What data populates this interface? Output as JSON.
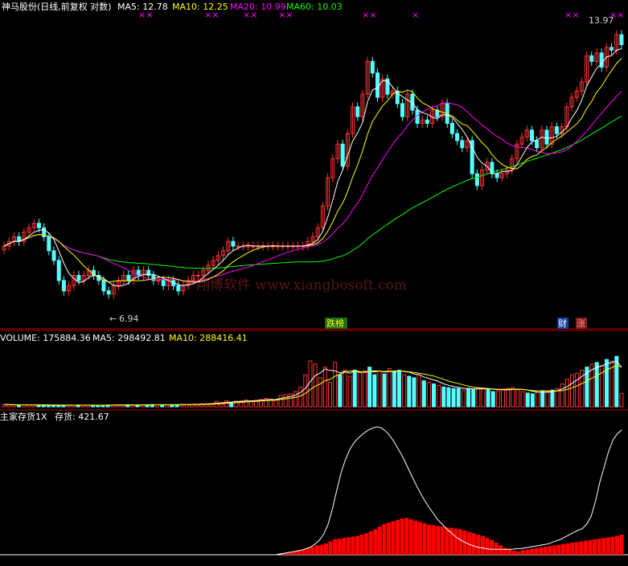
{
  "header": {
    "title": "神马股份(日线,前复权 对数)",
    "ma_items": [
      {
        "label": "MA5: 12.78",
        "color": "#ffffff"
      },
      {
        "label": "MA10: 12.25",
        "color": "#ffff00"
      },
      {
        "label": "MA20: 10.99",
        "color": "#ff00ff"
      },
      {
        "label": "MA60: 10.03",
        "color": "#00ff00"
      }
    ]
  },
  "price_panel": {
    "high_label": "13.97",
    "low_label": "6.94",
    "watermark": "翔博软件 www.xiangbosoft.com",
    "event_tags": [
      {
        "text": "跌榜",
        "color": "#ffff00",
        "bg": "#1a6a1a"
      },
      {
        "text": "财",
        "color": "#ffffff",
        "bg": "#1040a0"
      },
      {
        "text": "涨",
        "color": "#ff8080",
        "bg": "#802020"
      }
    ],
    "star_marks": [
      "××",
      "××",
      "××",
      "××",
      "××",
      "×",
      "××",
      "××"
    ]
  },
  "volume_panel": {
    "items": [
      {
        "label": "VOLUME: 175884.36",
        "color": "#ffffff"
      },
      {
        "label": "MA5: 298492.81",
        "color": "#ffffff"
      },
      {
        "label": "MA10: 288416.41",
        "color": "#ffff00"
      }
    ]
  },
  "indicator_panel": {
    "items": [
      {
        "label": "主家存货1X",
        "color": "#ffffff"
      },
      {
        "label": "存货: 421.67",
        "color": "#ffffff"
      }
    ]
  },
  "colors": {
    "up": "#ff3232",
    "down": "#54ffff",
    "ma5": "#ffffff",
    "ma10": "#ffff00",
    "ma20": "#ff00ff",
    "ma60": "#00ff00",
    "axis": "#b00000",
    "inventory_bar": "#ff0000",
    "inventory_line": "#ffffff"
  },
  "chart_data": [
    {
      "type": "candlestick",
      "title": "神马股份(日线,前复权 对数)",
      "scale": "log",
      "ylim": [
        6.5,
        14.5
      ],
      "closes": [
        7.9,
        8.0,
        8.1,
        8.0,
        8.2,
        8.3,
        8.4,
        8.3,
        8.1,
        7.8,
        7.6,
        7.2,
        7.0,
        7.1,
        7.3,
        7.2,
        7.3,
        7.4,
        7.3,
        7.2,
        7.0,
        6.94,
        7.1,
        7.2,
        7.3,
        7.2,
        7.4,
        7.3,
        7.4,
        7.3,
        7.2,
        7.2,
        7.1,
        7.2,
        7.1,
        7.0,
        7.1,
        7.2,
        7.3,
        7.3,
        7.4,
        7.5,
        7.6,
        7.7,
        7.8,
        8.0,
        7.9,
        7.9,
        7.9,
        7.9,
        7.9,
        7.9,
        7.9,
        7.9,
        7.9,
        7.9,
        7.9,
        7.9,
        7.9,
        7.9,
        7.9,
        8.0,
        8.1,
        8.3,
        8.8,
        9.5,
        10.0,
        10.4,
        9.8,
        10.7,
        11.5,
        11.2,
        11.9,
        13.0,
        12.6,
        11.8,
        12.4,
        11.9,
        12.0,
        11.6,
        11.2,
        11.9,
        11.4,
        11.0,
        11.1,
        11.0,
        11.4,
        11.2,
        11.6,
        11.0,
        10.7,
        10.5,
        10.3,
        10.5,
        9.6,
        9.3,
        9.7,
        9.9,
        9.6,
        9.5,
        9.6,
        9.7,
        10.0,
        10.4,
        10.6,
        10.8,
        10.5,
        10.3,
        10.8,
        10.4,
        10.9,
        10.7,
        10.9,
        11.5,
        11.8,
        12.0,
        12.3,
        13.2,
        13.0,
        13.3,
        12.8,
        13.5,
        13.4,
        13.97,
        13.6
      ],
      "ma5": 12.78,
      "ma10": 12.25,
      "ma20": 10.99,
      "ma60": 10.03,
      "high_mark": 13.97,
      "low_mark": 6.94
    },
    {
      "type": "bar",
      "title": "VOLUME",
      "ylim": [
        0,
        800000
      ],
      "values": [
        30000,
        28000,
        25000,
        22000,
        27000,
        26000,
        24000,
        23000,
        22000,
        20000,
        21000,
        19000,
        18000,
        20000,
        22000,
        24000,
        23000,
        21000,
        20000,
        19000,
        22000,
        24000,
        23000,
        26000,
        25000,
        27000,
        24000,
        23000,
        26000,
        28000,
        30000,
        27000,
        26000,
        25000,
        28000,
        29000,
        32000,
        30000,
        33000,
        35000,
        40000,
        42000,
        45000,
        70000,
        55000,
        80000,
        60000,
        75000,
        80000,
        90000,
        78000,
        85000,
        95000,
        110000,
        100000,
        90000,
        150000,
        160000,
        170000,
        200000,
        260000,
        420000,
        600000,
        560000,
        380000,
        520000,
        320000,
        580000,
        420000,
        480000,
        400000,
        480000,
        460000,
        470000,
        520000,
        420000,
        470000,
        430000,
        500000,
        470000,
        480000,
        420000,
        400000,
        380000,
        420000,
        340000,
        320000,
        300000,
        280000,
        260000,
        250000,
        240000,
        240000,
        220000,
        240000,
        230000,
        250000,
        240000,
        230000,
        200000,
        210000,
        230000,
        240000,
        250000,
        220000,
        200000,
        180000,
        170000,
        190000,
        210000,
        200000,
        220000,
        240000,
        300000,
        360000,
        420000,
        440000,
        480000,
        520000,
        560000,
        580000,
        540000,
        620000,
        600000,
        660000,
        175884
      ],
      "ma5": 298492.81,
      "ma10": 288416.41
    },
    {
      "type": "bar",
      "title": "主家存货1X",
      "value_label": 421.67,
      "bars": [
        0,
        0,
        0,
        0,
        0,
        0,
        0,
        0,
        0,
        0,
        0,
        0,
        0,
        0,
        0,
        0,
        0,
        0,
        0,
        0,
        0,
        0,
        0,
        0,
        0,
        0,
        0,
        0,
        0,
        0,
        0,
        0,
        0,
        0,
        0,
        0,
        0,
        0,
        0,
        0,
        0,
        0,
        0,
        0,
        0,
        0,
        0,
        0,
        0,
        0,
        0,
        0,
        0,
        0,
        0,
        0,
        0,
        0,
        0,
        0,
        0,
        0,
        0,
        3,
        4,
        5,
        7,
        8,
        10,
        12,
        14,
        15,
        17,
        20,
        23,
        24,
        25,
        26,
        27,
        28,
        30,
        32,
        35,
        38,
        42,
        46,
        48,
        50,
        52,
        54,
        55,
        53,
        51,
        49,
        47,
        45,
        44,
        43,
        42,
        41,
        40,
        39,
        38,
        36,
        34,
        32,
        30,
        28,
        25,
        22,
        18,
        14,
        10,
        8,
        6,
        5,
        7,
        8,
        9,
        10,
        11,
        12,
        13,
        14,
        15,
        16,
        17,
        18,
        19,
        20,
        21,
        22,
        23,
        24,
        25,
        26,
        27,
        28,
        30
      ],
      "line": [
        0,
        0,
        0,
        0,
        0,
        0,
        0,
        0,
        0,
        0,
        0,
        0,
        0,
        0,
        0,
        0,
        0,
        0,
        0,
        0,
        0,
        0,
        0,
        0,
        0,
        0,
        0,
        0,
        0,
        0,
        0,
        0,
        0,
        0,
        0,
        0,
        0,
        0,
        0,
        0,
        0,
        0,
        0,
        0,
        0,
        0,
        0,
        0,
        0,
        0,
        0,
        0,
        0,
        0,
        0,
        0,
        0,
        0,
        0,
        0,
        0,
        0,
        0,
        1,
        2,
        3,
        4,
        5,
        6,
        8,
        10,
        14,
        19,
        27,
        40,
        60,
        85,
        108,
        125,
        138,
        147,
        153,
        158,
        162,
        165,
        167,
        166,
        162,
        156,
        148,
        138,
        128,
        116,
        104,
        92,
        81,
        71,
        62,
        54,
        46,
        40,
        34,
        29,
        24,
        20,
        17,
        14,
        12,
        10,
        9,
        8,
        7,
        7,
        7,
        7,
        7,
        7,
        8,
        8,
        9,
        10,
        11,
        12,
        13,
        14,
        16,
        18,
        20,
        23,
        26,
        29,
        32,
        34,
        40,
        50,
        70,
        95,
        115,
        135,
        150,
        158,
        163
      ]
    }
  ]
}
